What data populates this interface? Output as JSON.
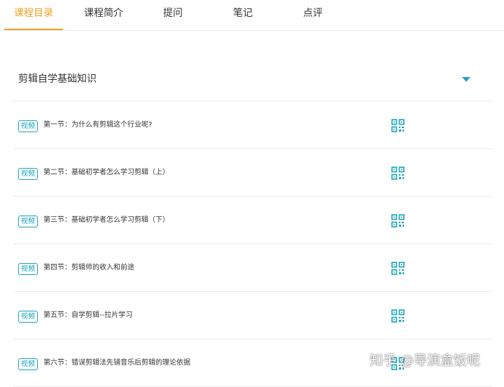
{
  "tabs": [
    {
      "label": "课程目录",
      "active": true
    },
    {
      "label": "课程简介",
      "active": false
    },
    {
      "label": "提问",
      "active": false
    },
    {
      "label": "笔记",
      "active": false
    },
    {
      "label": "点评",
      "active": false
    }
  ],
  "section": {
    "title": "剪辑自学基础知识",
    "toggle_icon": "caret-down-icon"
  },
  "lessons": [
    {
      "badge": "视频",
      "title": "第一节：为什么有剪辑这个行业呢?",
      "icon": "qr-code-icon"
    },
    {
      "badge": "视频",
      "title": "第二节：基础初学者怎么学习剪辑（上）",
      "icon": "qr-code-icon"
    },
    {
      "badge": "视频",
      "title": "第三节：基础初学者怎么学习剪辑（下）",
      "icon": "qr-code-icon"
    },
    {
      "badge": "视频",
      "title": "第四节：剪辑师的收入和前途",
      "icon": "qr-code-icon"
    },
    {
      "badge": "视频",
      "title": "第五节：自学剪辑--拉片学习",
      "icon": "qr-code-icon"
    },
    {
      "badge": "视频",
      "title": "第六节：错误剪辑法先铺音乐后剪辑的理论依据",
      "icon": "qr-code-icon"
    }
  ],
  "watermark": "知乎 @导演盒饭呢",
  "colors": {
    "accent": "#f0a020",
    "teal": "#17a2b8",
    "divider": "#ececec"
  }
}
